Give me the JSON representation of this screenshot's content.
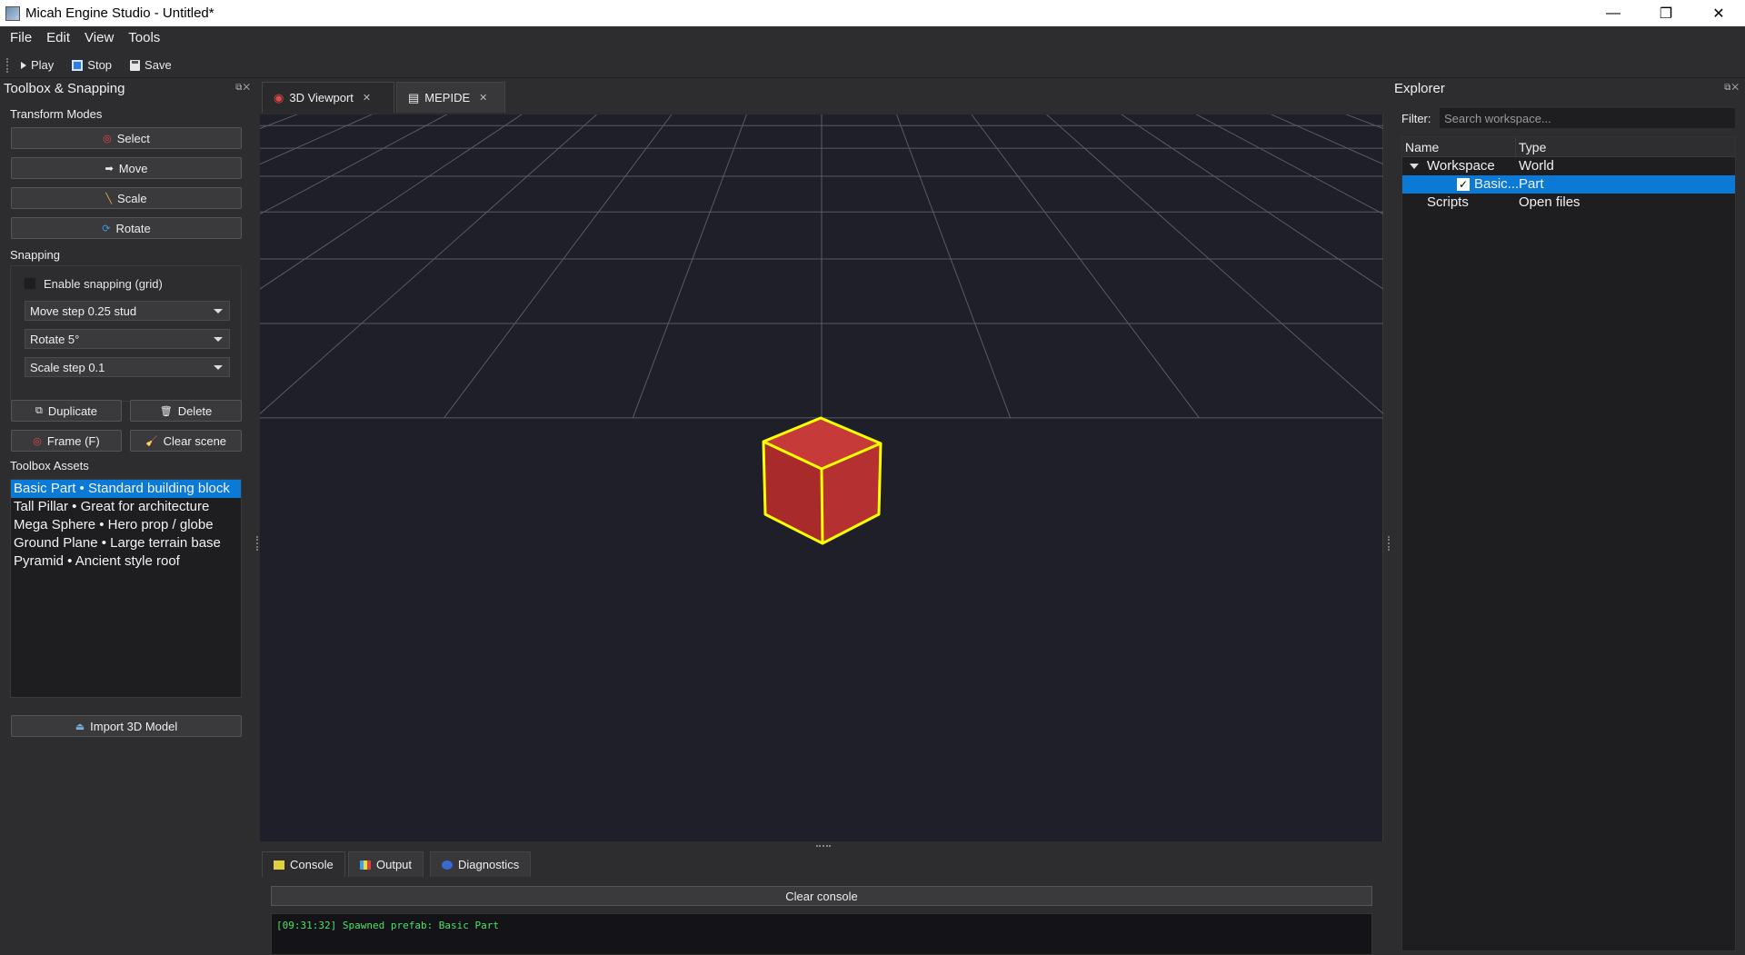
{
  "window": {
    "title": "Micah Engine Studio - Untitled*",
    "controls": {
      "minimize": "—",
      "restore": "❐",
      "close": "✕"
    }
  },
  "menu": {
    "items": [
      "File",
      "Edit",
      "View",
      "Tools"
    ]
  },
  "toolbar": {
    "play_label": "Play",
    "stop_label": "Stop",
    "save_label": "Save"
  },
  "left_dock": {
    "title": "Toolbox & Snapping",
    "transform_modes_label": "Transform Modes",
    "transform_modes": [
      {
        "label": "Select",
        "icon": "target-icon"
      },
      {
        "label": "Move",
        "icon": "arrow-right-icon"
      },
      {
        "label": "Scale",
        "icon": "ruler-icon"
      },
      {
        "label": "Rotate",
        "icon": "rotate-icon"
      }
    ],
    "snapping_label": "Snapping",
    "enable_snapping_label": "Enable snapping (grid)",
    "enable_snapping_checked": false,
    "move_step": "Move step 0.25 stud",
    "rotate_step": "Rotate 5°",
    "scale_step": "Scale step 0.1",
    "duplicate_label": "Duplicate",
    "delete_label": "Delete",
    "frame_label": "Frame (F)",
    "clear_scene_label": "Clear scene",
    "toolbox_assets_label": "Toolbox Assets",
    "assets": [
      "Basic Part • Standard building block",
      "Tall Pillar • Great for architecture",
      "Mega Sphere • Hero prop / globe",
      "Ground Plane • Large terrain base",
      "Pyramid • Ancient style roof"
    ],
    "selected_asset_index": 0,
    "import_label": "Import 3D Model"
  },
  "center": {
    "tabs": [
      {
        "label": "3D Viewport",
        "active": true
      },
      {
        "label": "MEPIDE",
        "active": false
      }
    ],
    "viewport": {
      "grid_color": "#5a5a66",
      "background": "#1f1f29",
      "selected_object": {
        "type": "cube",
        "color": "#b52a2a",
        "outline": "#ffff00"
      }
    },
    "bottom_tabs": [
      {
        "label": "Console",
        "active": true
      },
      {
        "label": "Output",
        "active": false
      },
      {
        "label": "Diagnostics",
        "active": false
      }
    ],
    "clear_console_label": "Clear console",
    "console_lines": [
      "[09:31:32] Spawned prefab: Basic Part"
    ]
  },
  "explorer": {
    "title": "Explorer",
    "filter_label": "Filter:",
    "filter_placeholder": "Search workspace...",
    "filter_value": "",
    "columns": [
      "Name",
      "Type"
    ],
    "rows": [
      {
        "name": "Workspace",
        "type": "World",
        "expanded": true
      },
      {
        "name": "Basic...",
        "type": "Part",
        "checked": true,
        "selected": true
      },
      {
        "name": "Scripts",
        "type": "Open files"
      }
    ]
  },
  "colors": {
    "accent": "#0a7ad6",
    "console_text": "#4ee06a"
  }
}
